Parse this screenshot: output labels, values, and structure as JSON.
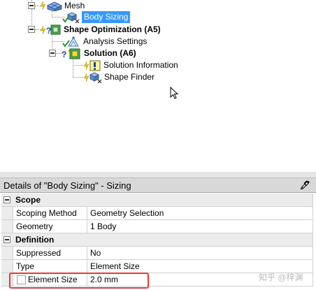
{
  "tree": {
    "items": [
      {
        "label": "Mesh",
        "bold": false,
        "selected": false,
        "icon": "mesh-icon"
      },
      {
        "label": "Body Sizing",
        "bold": false,
        "selected": true,
        "icon": "body-sizing-icon"
      },
      {
        "label": "Shape Optimization (A5)",
        "bold": true,
        "selected": false,
        "icon": "shape-optimization-icon"
      },
      {
        "label": "Analysis Settings",
        "bold": false,
        "selected": false,
        "icon": "analysis-settings-icon"
      },
      {
        "label": "Solution (A6)",
        "bold": true,
        "selected": false,
        "icon": "solution-icon"
      },
      {
        "label": "Solution Information",
        "bold": false,
        "selected": false,
        "icon": "solution-information-icon"
      },
      {
        "label": "Shape Finder",
        "bold": false,
        "selected": false,
        "icon": "shape-finder-icon"
      }
    ]
  },
  "details": {
    "title": "Details of \"Body Sizing\" - Sizing",
    "pin_icon": "pin-icon",
    "sections": [
      {
        "name": "Scope",
        "rows": [
          {
            "key": "Scoping Method",
            "value": "Geometry Selection"
          },
          {
            "key": "Geometry",
            "value": "1 Body"
          }
        ]
      },
      {
        "name": "Definition",
        "rows": [
          {
            "key": "Suppressed",
            "value": "No"
          },
          {
            "key": "Type",
            "value": "Element Size"
          },
          {
            "key": "Element Size",
            "value": "2.0 mm",
            "checkbox": true
          }
        ]
      }
    ]
  },
  "watermark": "知乎 @梓渊",
  "colors": {
    "selection": "#3399ff",
    "highlight_box": "#e53935",
    "details_header": "#d8d8d8"
  }
}
